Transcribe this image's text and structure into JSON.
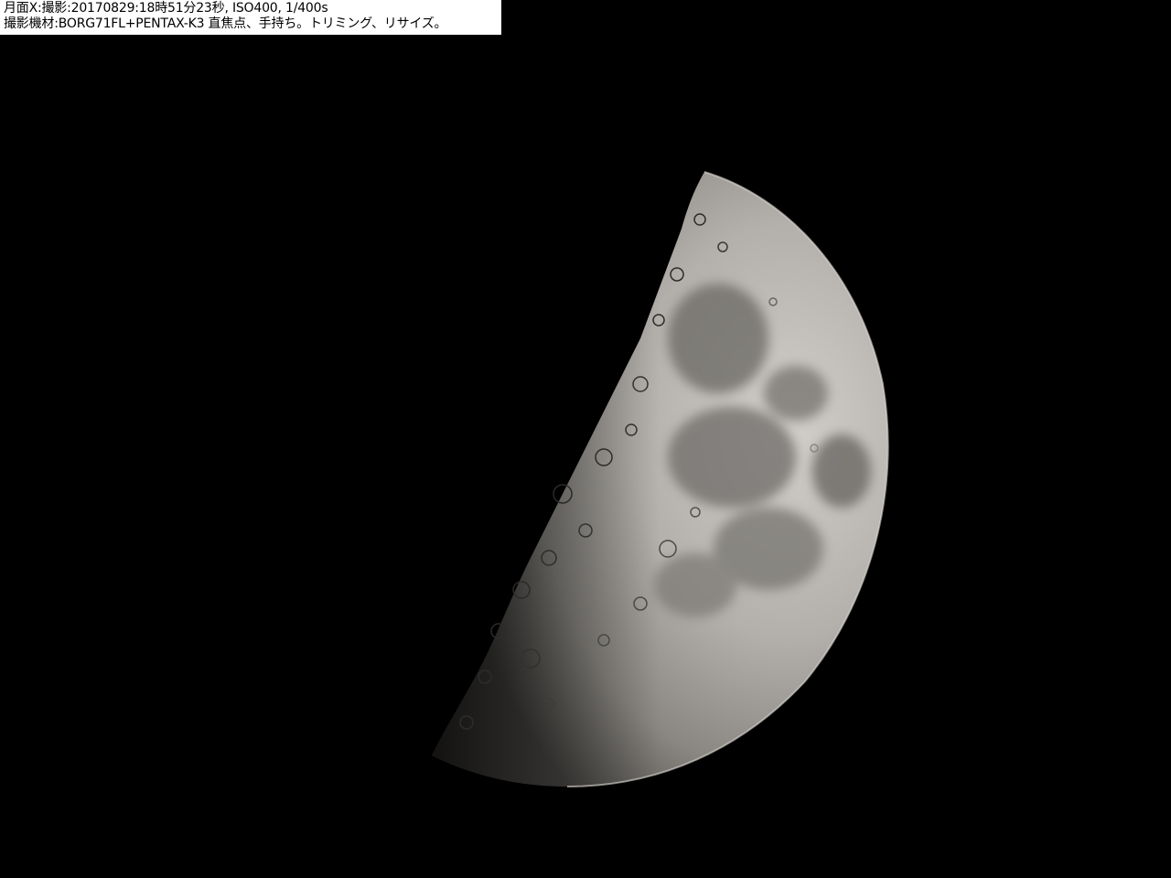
{
  "caption": {
    "line1": "月面X:撮影:20170829:18時51分23秒, ISO400, 1/400s",
    "line2": "撮影機材:BORG71FL+PENTAX-K3 直焦点、手持ち。トリミング、リサイズ。"
  },
  "scene": {
    "subject": "first-quarter-moon",
    "background_color": "#000000",
    "moon_bright_color": "#c9c6c1",
    "moon_shadow_color": "#3a3835",
    "maria_color": "#6f6c68"
  }
}
